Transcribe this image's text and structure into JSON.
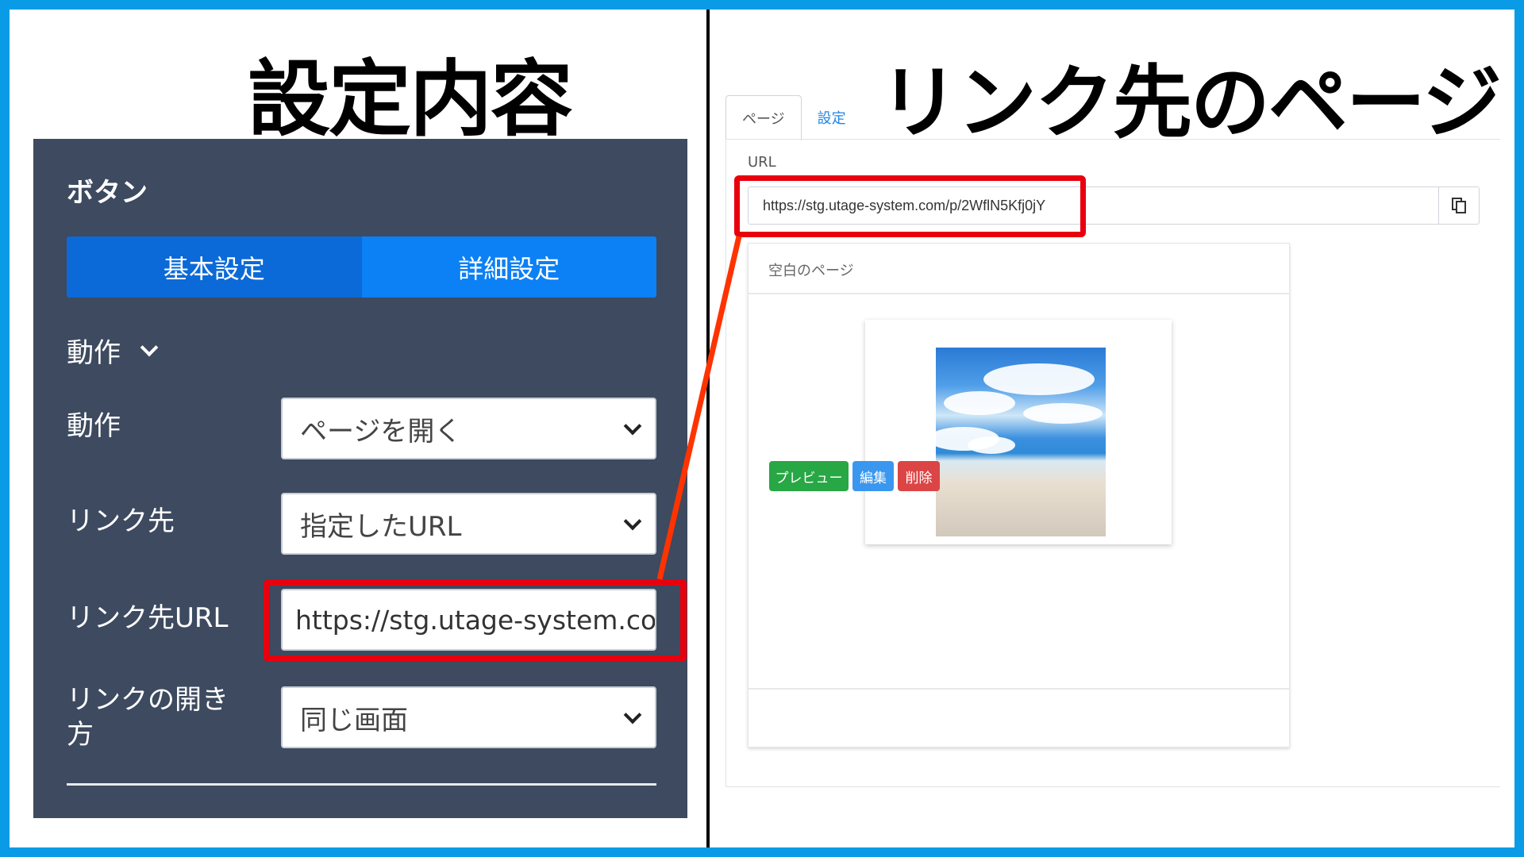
{
  "left": {
    "title": "設定内容",
    "panel_heading": "ボタン",
    "tabs": [
      "基本設定",
      "詳細設定"
    ],
    "section": "動作",
    "rows": [
      {
        "label": "動作",
        "value": "ページを開く"
      },
      {
        "label": "リンク先",
        "value": "指定したURL"
      },
      {
        "label": "リンク先URL",
        "value": "https://stg.utage-system.com/"
      },
      {
        "label_line1": "リンクの開き",
        "label_line2": "方",
        "value": "同じ画面"
      }
    ]
  },
  "right": {
    "title": "リンク先のページ",
    "tabs": [
      "ページ",
      "設定"
    ],
    "url_label": "URL",
    "url_value": "https://stg.utage-system.com/p/2WflN5Kfj0jY",
    "card_title": "空白のページ",
    "buttons": {
      "preview": "プレビュー",
      "edit": "編集",
      "delete": "削除"
    }
  },
  "colors": {
    "frame": "#0a9be6",
    "panel_bg": "#3d4a5f",
    "tab_basic": "#0b6ad8",
    "tab_detail": "#0c80f5",
    "highlight": "#e8000f",
    "connector": "#ff3300",
    "preview_btn": "#28a745",
    "edit_btn": "#3a97f0",
    "delete_btn": "#dc4545"
  }
}
